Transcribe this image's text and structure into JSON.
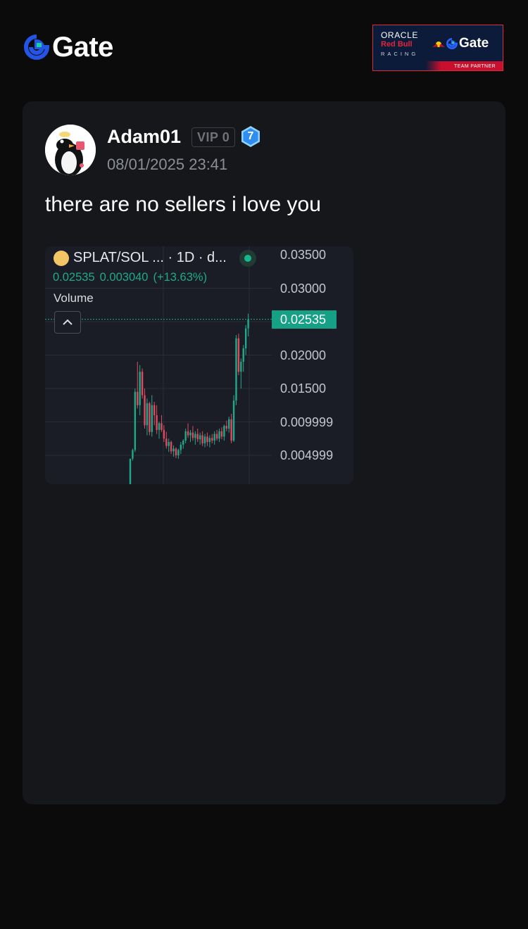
{
  "brand": {
    "name": "Gate",
    "logo_icon": "gate-logo-icon"
  },
  "partner_banner": {
    "oracle": "ORACLE",
    "red_bull": "Red Bull",
    "racing": "RACING",
    "gate": "Gate",
    "team_partner": "TEAM PARTNER",
    "colors": {
      "navy": "#0c1b3a",
      "red": "#c8102e"
    }
  },
  "post": {
    "username": "Adam01",
    "vip_label": "VIP 0",
    "level": "7",
    "timestamp": "08/01/2025 23:41",
    "text": "there are no sellers i love you",
    "avatar_icon": "penguin-avatar"
  },
  "chart_widget": {
    "title": "SPLAT/SOL ...  · 1D · d...",
    "last_price": "0.02535",
    "change": "0.003040",
    "change_pct": "(+13.63%)",
    "volume_label": "Volume",
    "current_price_tag": "0.02535",
    "colors": {
      "up": "#1fa98a",
      "down": "#e04a5f",
      "background": "#1b1d26"
    }
  },
  "chart_data": {
    "type": "candlestick",
    "title": "SPLAT/SOL",
    "y_ticks": [
      "0.03500",
      "0.03000",
      "0.02535",
      "0.02000",
      "0.01500",
      "0.009999",
      "0.004999"
    ],
    "ylim": [
      0,
      0.0375
    ],
    "grid": true,
    "candles": [
      [
        0.0007,
        0.0045,
        0.0005,
        0.0045
      ],
      [
        0.0045,
        0.006,
        0.0042,
        0.0058
      ],
      [
        0.0058,
        0.015,
        0.0055,
        0.0145
      ],
      [
        0.0145,
        0.019,
        0.012,
        0.0125
      ],
      [
        0.0125,
        0.0185,
        0.011,
        0.0175
      ],
      [
        0.0175,
        0.018,
        0.0135,
        0.014
      ],
      [
        0.014,
        0.015,
        0.009,
        0.0095
      ],
      [
        0.0095,
        0.0135,
        0.008,
        0.0128
      ],
      [
        0.0128,
        0.013,
        0.008,
        0.0085
      ],
      [
        0.0085,
        0.014,
        0.0078,
        0.0125
      ],
      [
        0.0125,
        0.013,
        0.0095,
        0.011
      ],
      [
        0.011,
        0.0125,
        0.0082,
        0.0088
      ],
      [
        0.0088,
        0.01,
        0.0075,
        0.0098
      ],
      [
        0.0098,
        0.011,
        0.0085,
        0.0088
      ],
      [
        0.0088,
        0.0095,
        0.007,
        0.0075
      ],
      [
        0.0075,
        0.0085,
        0.006,
        0.0064
      ],
      [
        0.0064,
        0.0075,
        0.0055,
        0.007
      ],
      [
        0.007,
        0.0072,
        0.0052,
        0.0056
      ],
      [
        0.0056,
        0.0065,
        0.0048,
        0.006
      ],
      [
        0.006,
        0.0062,
        0.0046,
        0.005
      ],
      [
        0.005,
        0.006,
        0.0045,
        0.0058
      ],
      [
        0.0058,
        0.007,
        0.0052,
        0.0066
      ],
      [
        0.0066,
        0.0074,
        0.006,
        0.0072
      ],
      [
        0.0072,
        0.009,
        0.0068,
        0.0086
      ],
      [
        0.0086,
        0.0098,
        0.0076,
        0.008
      ],
      [
        0.008,
        0.0088,
        0.007,
        0.0084
      ],
      [
        0.0084,
        0.0094,
        0.0072,
        0.0076
      ],
      [
        0.0076,
        0.0086,
        0.0066,
        0.0082
      ],
      [
        0.0082,
        0.009,
        0.007,
        0.0074
      ],
      [
        0.0074,
        0.0084,
        0.0066,
        0.008
      ],
      [
        0.008,
        0.0086,
        0.0064,
        0.0068
      ],
      [
        0.0068,
        0.0082,
        0.0062,
        0.0078
      ],
      [
        0.0078,
        0.0084,
        0.0064,
        0.007
      ],
      [
        0.007,
        0.008,
        0.0062,
        0.0076
      ],
      [
        0.0076,
        0.0082,
        0.0068,
        0.0072
      ],
      [
        0.0072,
        0.0086,
        0.0066,
        0.0082
      ],
      [
        0.0082,
        0.0088,
        0.0072,
        0.0075
      ],
      [
        0.0075,
        0.009,
        0.007,
        0.0086
      ],
      [
        0.0086,
        0.0092,
        0.0074,
        0.0078
      ],
      [
        0.0078,
        0.0096,
        0.0072,
        0.0094
      ],
      [
        0.0094,
        0.0102,
        0.0086,
        0.009
      ],
      [
        0.009,
        0.0108,
        0.0084,
        0.0104
      ],
      [
        0.0104,
        0.0112,
        0.0068,
        0.0072
      ],
      [
        0.0072,
        0.014,
        0.007,
        0.0132
      ],
      [
        0.0132,
        0.023,
        0.0125,
        0.0225
      ],
      [
        0.0225,
        0.0232,
        0.017,
        0.0175
      ],
      [
        0.0175,
        0.0195,
        0.015,
        0.019
      ],
      [
        0.019,
        0.0215,
        0.0175,
        0.021
      ],
      [
        0.021,
        0.0245,
        0.02,
        0.024
      ],
      [
        0.024,
        0.0262,
        0.0228,
        0.02535
      ]
    ]
  }
}
